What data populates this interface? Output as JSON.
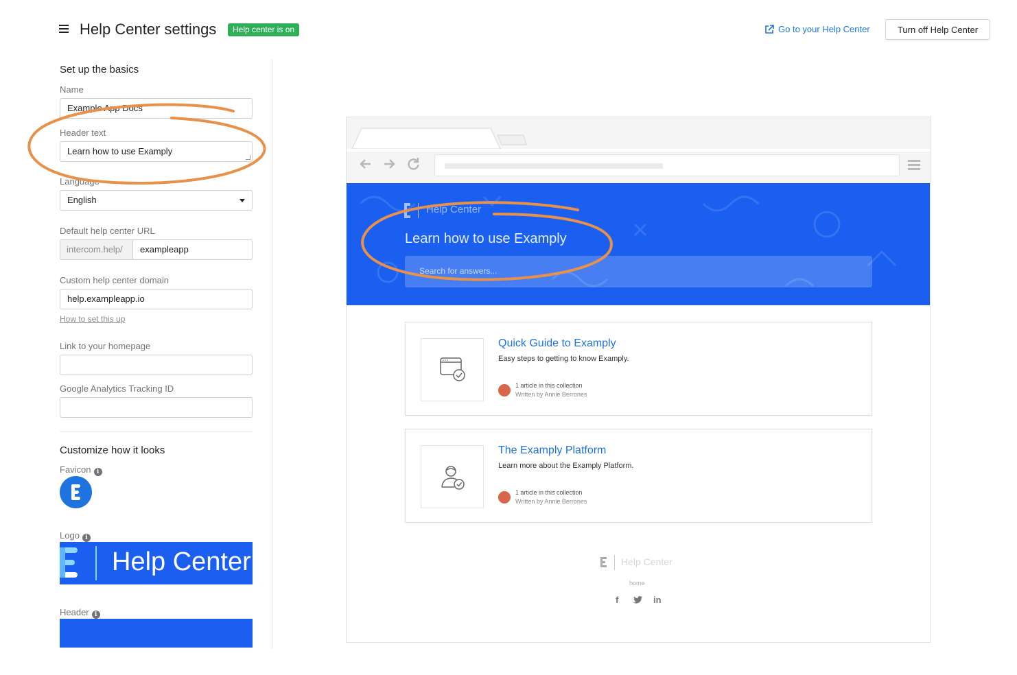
{
  "header": {
    "title": "Help Center settings",
    "status_badge": "Help center is on",
    "goto_link": "Go to your Help Center",
    "turn_off_button": "Turn off Help Center"
  },
  "basics": {
    "section_title": "Set up the basics",
    "name_label": "Name",
    "name_value": "Example App Docs",
    "header_text_label": "Header text",
    "header_text_value": "Learn how to use Examply",
    "language_label": "Language",
    "language_value": "English",
    "default_url_label": "Default help center URL",
    "default_url_prefix": "intercom.help/",
    "default_url_value": "exampleapp",
    "custom_domain_label": "Custom help center domain",
    "custom_domain_value": "help.exampleapp.io",
    "how_to_link": "How to set this up",
    "homepage_label": "Link to your homepage",
    "homepage_value": "",
    "ga_label": "Google Analytics Tracking ID",
    "ga_value": ""
  },
  "customize": {
    "section_title": "Customize how it looks",
    "favicon_label": "Favicon",
    "logo_label": "Logo",
    "logo_text": "Help Center",
    "header_label": "Header"
  },
  "preview": {
    "hero_logo_text": "Help Center",
    "hero_title": "Learn how to use Examply",
    "search_placeholder": "Search for answers...",
    "collections": [
      {
        "title": "Quick Guide to Examply",
        "description": "Easy steps to getting to know Examply.",
        "count": "1 article in this collection",
        "author": "Written by Annie Berrones"
      },
      {
        "title": "The Examply Platform",
        "description": "Learn more about the Examply Platform.",
        "count": "1 article in this collection",
        "author": "Written by Annie Berrones"
      }
    ],
    "footer_logo_text": "Help Center",
    "footer_link": "home"
  },
  "colors": {
    "accent": "#1f73e0",
    "hero_blue": "#1a5ff0",
    "badge_green": "#2eb05b",
    "annotation_orange": "#e8914a"
  },
  "icons": [
    "menu-icon",
    "external-link-icon",
    "info-icon",
    "favicon-logo-icon",
    "back-arrow-icon",
    "forward-arrow-icon",
    "reload-icon",
    "browser-menu-icon",
    "collection-window-icon",
    "collection-person-icon",
    "facebook-icon",
    "twitter-icon",
    "linkedin-icon"
  ]
}
